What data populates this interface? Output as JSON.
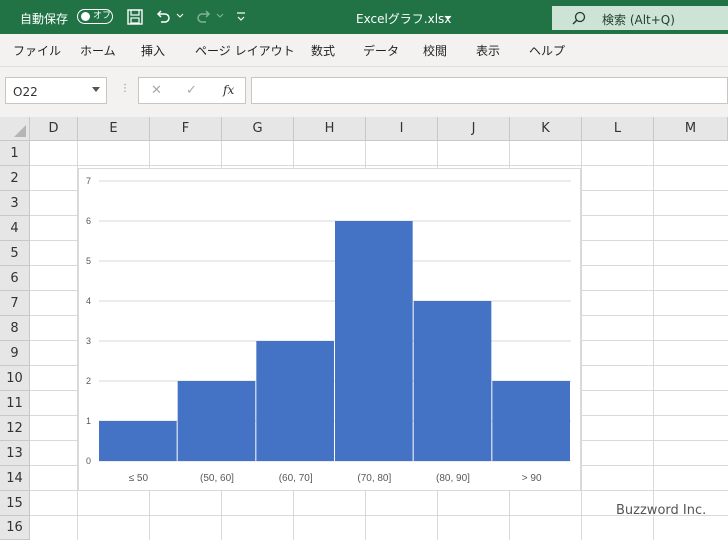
{
  "titlebar": {
    "autosave_label": "自動保存",
    "autosave_state": "オフ",
    "filename": "Excelグラフ.xlsx",
    "search_label": "検索 (Alt+Q)"
  },
  "ribbon": {
    "tabs": [
      "ファイル",
      "ホーム",
      "挿入",
      "ページ レイアウト",
      "数式",
      "データ",
      "校閲",
      "表示",
      "ヘルプ"
    ]
  },
  "formula_bar": {
    "name_box": "O22",
    "fx_label": "fx",
    "formula": ""
  },
  "grid": {
    "columns": [
      "D",
      "E",
      "F",
      "G",
      "H",
      "I",
      "J",
      "K",
      "L",
      "M"
    ],
    "rows": [
      "1",
      "2",
      "3",
      "4",
      "5",
      "6",
      "7",
      "8",
      "9",
      "10",
      "11",
      "12",
      "13",
      "14",
      "15",
      "16"
    ]
  },
  "chart_data": {
    "type": "bar",
    "categories": [
      "≤ 50",
      "(50, 60]",
      "(60, 70]",
      "(70, 80]",
      "(80, 90]",
      "> 90"
    ],
    "values": [
      1,
      2,
      3,
      6,
      4,
      2
    ],
    "ylim": [
      0,
      7
    ],
    "yticks": [
      0,
      1,
      2,
      3,
      4,
      5,
      6,
      7
    ],
    "grid": true,
    "bar_color": "#4472c4"
  },
  "watermark": "Buzzword Inc.",
  "colors": {
    "titlebar": "#217346",
    "bar": "#4472c4"
  }
}
